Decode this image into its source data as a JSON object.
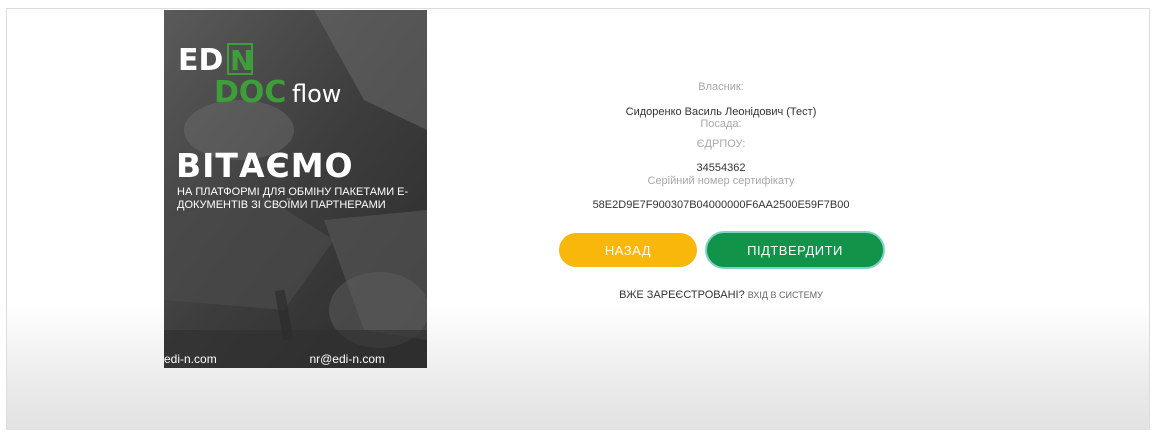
{
  "promo": {
    "logo_line1": "ED",
    "logo_n": "N",
    "logo_doc": "DOC",
    "logo_flow": "flow",
    "welcome": "ВІТАЄМО",
    "tagline": "НА ПЛАТФОРМІ ДЛЯ ОБМІНУ ПАКЕТАМИ Е-ДОКУМЕНТІВ ЗІ СВОЇМИ ПАРТНЕРАМИ",
    "site": "edi-n.com",
    "email": "nr@edi-n.com"
  },
  "info": {
    "owner_label": "Власник:",
    "owner_value": "Сидоренко Василь Леонідович (Тест)",
    "position_label": "Посада:",
    "position_value": "",
    "edrpou_label": "ЄДРПОУ:",
    "edrpou_value": "34554362",
    "serial_label": "Серійний номер сертифікату",
    "serial_value": "58E2D9E7F900307B04000000F6AA2500E59F7B00"
  },
  "buttons": {
    "back": "НАЗАД",
    "confirm": "ПІДТВЕРДИТИ"
  },
  "footer": {
    "already_registered": "ВЖЕ ЗАРЕЄСТРОВАНІ?",
    "login_link": "ВХІД В СИСТЕМУ"
  },
  "colors": {
    "back_button": "#f8b70a",
    "confirm_button": "#11944a",
    "logo_green": "#3e9e3a"
  }
}
